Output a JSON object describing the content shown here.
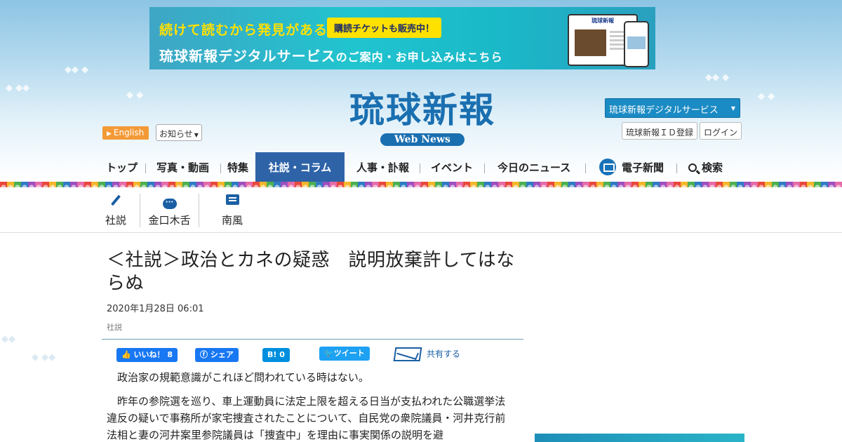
{
  "banner": {
    "tagline": "続けて読むから発見がある",
    "badge": "購読チケットも販売中！",
    "main_a": "琉球新報デジタルサービス",
    "main_b": "のご案内・お申し込み",
    "main_c": "はこちら",
    "device_title": "琉球新報"
  },
  "header": {
    "logo_text": "琉球新報",
    "logo_sub": "Web News",
    "english_label": "English",
    "news_label": "お知らせ",
    "digital_service_label": "琉球新報デジタルサービス",
    "id_register_label": "琉球新報ＩＤ登録",
    "login_label": "ログイン"
  },
  "nav": {
    "items": [
      "トップ",
      "写真・動画",
      "特集",
      "社説・コラム",
      "人事・訃報",
      "イベント",
      "今日のニュース",
      "電子新聞",
      "検索"
    ],
    "active": "社説・コラム"
  },
  "subnav": {
    "items": [
      "社説",
      "金口木舌",
      "南風"
    ]
  },
  "article": {
    "title": "＜社説＞政治とカネの疑惑　説明放棄許してはならぬ",
    "date": "2020年1月28日 06:01",
    "category": "社説",
    "share": {
      "like": "いいね！ 8",
      "facebook": "シェア",
      "hatena": "B! 0",
      "twitter": "ツイート",
      "mail": "共有する"
    },
    "paragraphs": [
      "政治家の規範意識がこれほど問われている時はない。",
      "昨年の参院選を巡り、車上運動員に法定上限を超える日当が支払われた公職選挙法違反の疑いで事務所が家宅捜査されたことについて、自民党の衆院議員・河井克行前法相と妻の河井案里参院議員は「捜査中」を理由に事実関係の説明を避"
    ]
  },
  "colors": {
    "brand_blue": "#1a6fb0",
    "nav_active": "#2e63a8",
    "english_orange": "#f39a36",
    "banner_yellow": "#ffe100"
  }
}
